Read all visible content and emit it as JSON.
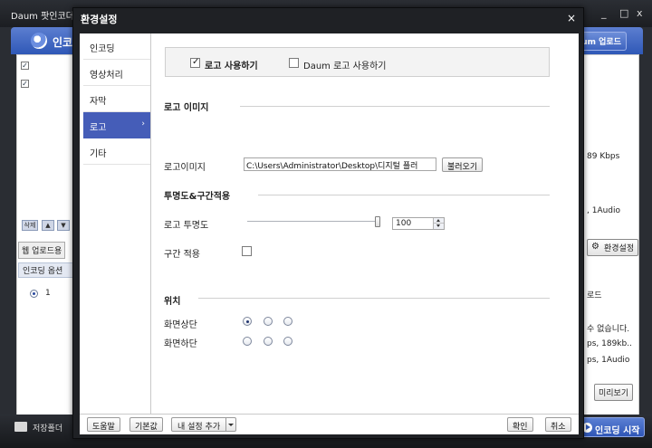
{
  "background_app": {
    "title": "Daum 팟인코더 ▾",
    "header_text": "인코",
    "upload_button": "Daum 업로드",
    "left_tab": "웹 업로드용",
    "left_section": "인코딩 옵션",
    "left_list_item": "1",
    "right_settings_button": "환경설정",
    "right_texts": [
      "89 Kbps",
      ", 1Audio",
      "로드",
      "수 없습니다.",
      "ps, 189kb..",
      "ps, 1Audio"
    ],
    "preview_button": "미리보기",
    "save_folder_label": "저장폴더",
    "start_button": "인코딩 시작",
    "window_controls": [
      "_",
      "□",
      "x"
    ],
    "list_controls": [
      "삭제",
      "▲",
      "▼"
    ]
  },
  "dialog": {
    "title": "환경설정",
    "close_glyph": "×",
    "nav_items": [
      {
        "label": "인코딩",
        "active": false
      },
      {
        "label": "영상처리",
        "active": false
      },
      {
        "label": "자막",
        "active": false
      },
      {
        "label": "로고",
        "active": true,
        "chevron": "›"
      },
      {
        "label": "기타",
        "active": false
      }
    ],
    "logo_options": {
      "use_logo": {
        "label": "로고 사용하기",
        "checked": true
      },
      "use_daum_logo": {
        "label": "Daum 로고 사용하기",
        "checked": false
      }
    },
    "logo_image": {
      "section_title": "로고 이미지",
      "field_label": "로고이미지",
      "path_value": "C:\\Users\\Administrator\\Desktop\\디지털 플러",
      "browse_button": "불러오기"
    },
    "transparency": {
      "section_title": "투명도&구간적용",
      "opacity_label": "로고 투명도",
      "opacity_value": "100",
      "opacity_fraction": 0.97,
      "range_label": "구간 적용",
      "range_checked": false
    },
    "position": {
      "section_title": "위치",
      "rows": [
        {
          "label": "화면상단",
          "selected_index": 0
        },
        {
          "label": "화면하단",
          "selected_index": -1
        }
      ]
    },
    "footer": {
      "help_button": "도움말",
      "default_button": "기본값",
      "add_setting_button": "내 설정 추가",
      "ok_button": "확인",
      "cancel_button": "취소"
    }
  }
}
